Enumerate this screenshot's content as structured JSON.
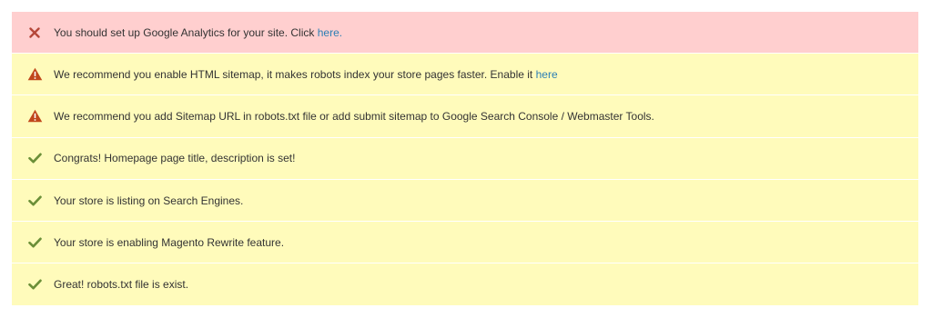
{
  "messages": [
    {
      "type": "error",
      "icon": "x-icon",
      "text": "You should set up Google Analytics for your site. Click",
      "link": "here."
    },
    {
      "type": "warning",
      "icon": "warning-icon",
      "text": "We recommend you enable HTML sitemap, it makes robots index your store pages faster. Enable it",
      "link": "here"
    },
    {
      "type": "warning",
      "icon": "warning-icon",
      "text": "We recommend you add Sitemap URL in robots.txt file or add submit sitemap to Google Search Console / Webmaster Tools."
    },
    {
      "type": "success",
      "icon": "checkmark-icon",
      "text": "Congrats! Homepage page title, description is set!"
    },
    {
      "type": "success",
      "icon": "checkmark-icon",
      "text": "Your store is listing on Search Engines."
    },
    {
      "type": "success",
      "icon": "checkmark-icon",
      "text": "Your store is enabling Magento Rewrite feature."
    },
    {
      "type": "success",
      "icon": "checkmark-icon",
      "text": "Great! robots.txt file is exist."
    }
  ],
  "colors": {
    "error_bg": "#ffcfcf",
    "notice_bg": "#fffbbb",
    "error_icon": "#b5483a",
    "warning_icon": "#c0471b",
    "success_icon": "#6b8f38",
    "link": "#2b7fb5"
  }
}
